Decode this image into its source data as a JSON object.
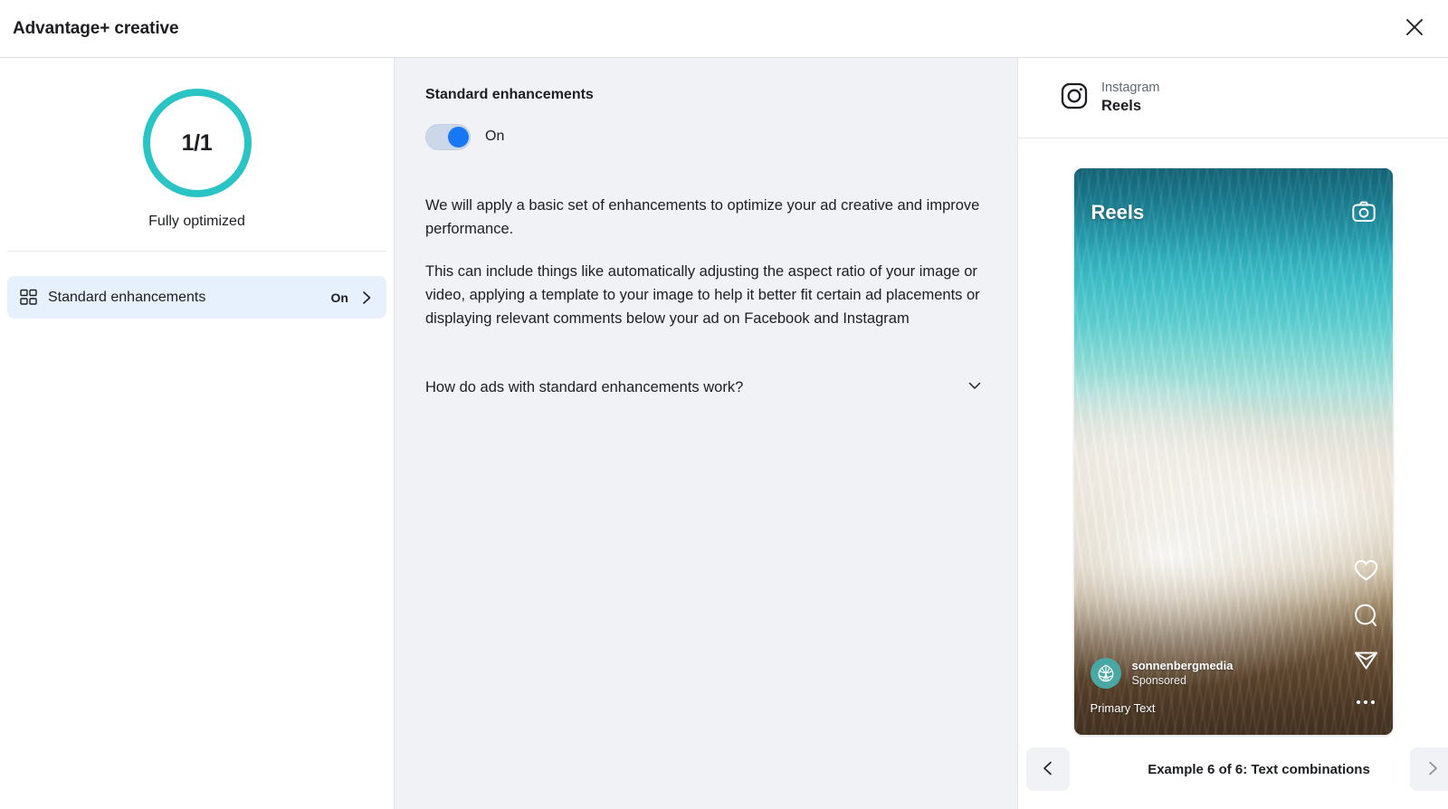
{
  "window": {
    "title": "Advantage+ creative",
    "close_icon": "close-icon"
  },
  "sidebar": {
    "progress": {
      "value_label": "1/1",
      "caption": "Fully optimized",
      "ring_color": "#2ac4c4",
      "percent": 100
    },
    "items": [
      {
        "icon": "grid-2x2-icon",
        "label": "Standard enhancements",
        "value": "On",
        "chevron": "chevron-right-icon",
        "selected": true
      }
    ]
  },
  "main": {
    "title": "Standard enhancements",
    "toggle": {
      "state_label": "On",
      "checked": true,
      "knob_color": "#1877f2",
      "track_color": "#ccd7ea"
    },
    "paragraphs": [
      "We will apply a basic set of enhancements to optimize your ad creative and improve performance.",
      "This can include things like automatically adjusting the aspect ratio of your image or video, applying a template to your image to help it better fit certain ad placements or displaying relevant comments below your ad on Facebook and Instagram"
    ],
    "accordion": {
      "label": "How do ads with standard enhancements work?",
      "icon": "chevron-down-icon",
      "expanded": false
    }
  },
  "preview": {
    "placement": {
      "icon": "instagram-icon",
      "platform": "Instagram",
      "surface": "Reels"
    },
    "phone": {
      "overlay_title": "Reels",
      "camera_icon": "camera-icon",
      "actions": [
        {
          "icon": "heart-icon",
          "name": "like"
        },
        {
          "icon": "comment-icon",
          "name": "comment"
        },
        {
          "icon": "send-icon",
          "name": "share"
        },
        {
          "icon": "more-dots-icon",
          "name": "more-options"
        }
      ],
      "advertiser": {
        "avatar_icon": "leaf-logo-icon",
        "avatar_color": "#4aa8a4",
        "name": "sonnenbergmedia",
        "label": "Sponsored"
      },
      "primary_text": "Primary Text"
    },
    "carousel": {
      "prev_icon": "chevron-left-icon",
      "next_icon": "chevron-right-icon",
      "caption": "Example 6 of 6: Text combinations"
    }
  }
}
